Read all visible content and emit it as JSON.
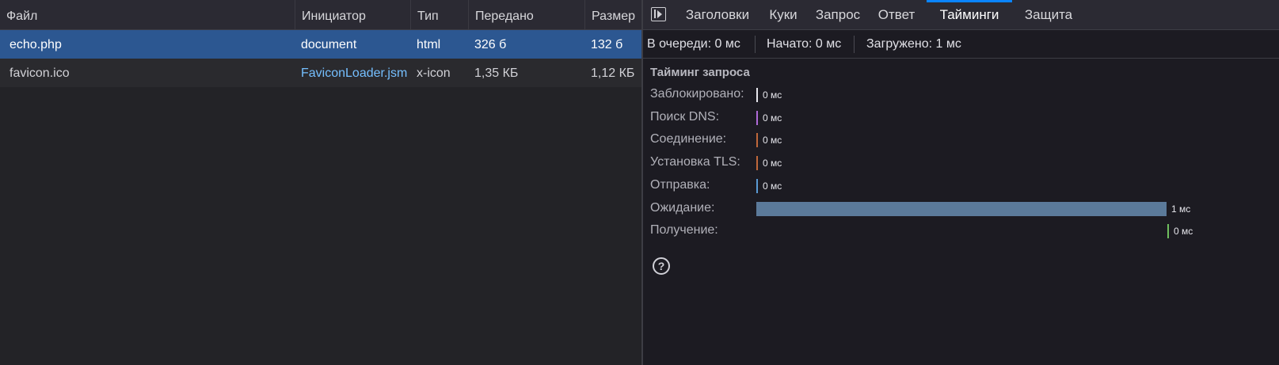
{
  "table": {
    "headers": {
      "file": "Файл",
      "initiator": "Инициатор",
      "type": "Тип",
      "transferred": "Передано",
      "size": "Размер"
    },
    "rows": [
      {
        "file": "echo.php",
        "initiator": "document",
        "type": "html",
        "transferred": "326 б",
        "size": "132 б"
      },
      {
        "file": "favicon.ico",
        "initiator": "FaviconLoader.jsm",
        "type": "x-icon",
        "transferred": "1,35 КБ",
        "size": "1,12 КБ"
      }
    ]
  },
  "tabs": {
    "headers": "Заголовки",
    "cookies": "Куки",
    "request": "Запрос",
    "response": "Ответ",
    "timings": "Тайминги",
    "security": "Защита"
  },
  "summary": {
    "queued": "В очереди: 0 мс",
    "started": "Начато: 0 мс",
    "loaded": "Загружено: 1 мс"
  },
  "timing": {
    "title": "Тайминг запроса",
    "items": [
      {
        "label": "Заблокировано:",
        "value": "0 мс",
        "color": "#e6e6ec"
      },
      {
        "label": "Поиск DNS:",
        "value": "0 мс",
        "color": "#b06ad8"
      },
      {
        "label": "Соединение:",
        "value": "0 мс",
        "color": "#c0683a"
      },
      {
        "label": "Установка TLS:",
        "value": "0 мс",
        "color": "#c0683a"
      },
      {
        "label": "Отправка:",
        "value": "0 мс",
        "color": "#5a9bd5"
      },
      {
        "label": "Ожидание:",
        "value": "1 мс",
        "color": "#5b7a9a"
      },
      {
        "label": "Получение:",
        "value": "0 мс",
        "color": "#6fbf5e"
      }
    ]
  },
  "colors": {
    "selected_row": "#2c5791",
    "active_tab": "#0a84ff",
    "link": "#75bfff"
  },
  "icons": {
    "panel_toggle": "panel-toggle-icon",
    "help": "help-icon"
  }
}
